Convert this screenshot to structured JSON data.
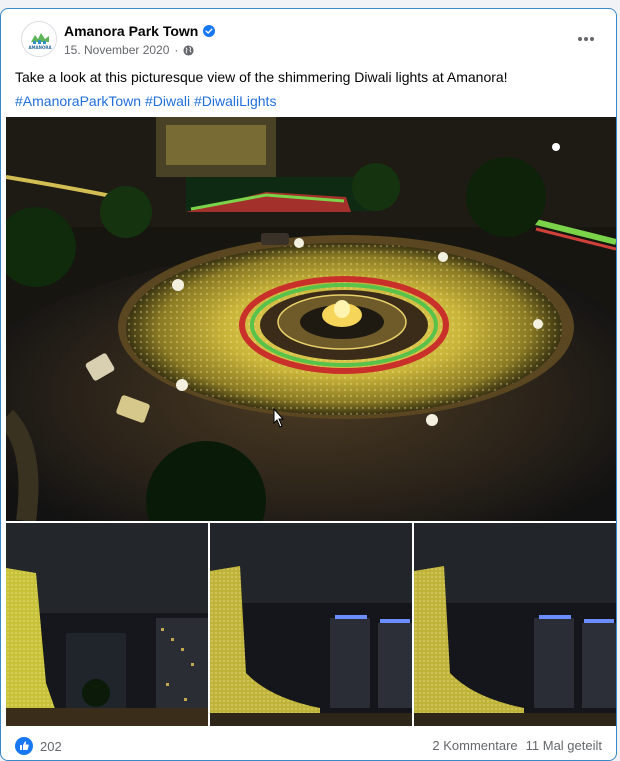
{
  "post": {
    "page_name": "Amanora Park Town",
    "avatar_text": "AMANORA",
    "date": "15. November 2020",
    "caption": "Take a look at this picturesque view of the shimmering Diwali lights at Amanora!",
    "hashtags": [
      "#AmanoraParkTown",
      "#Diwali",
      "#DiwaliLights"
    ]
  },
  "footer": {
    "reaction_count": "202",
    "comments": "2 Kommentare",
    "shares": "11 Mal geteilt"
  },
  "icons": {
    "verified": "verified-badge-icon",
    "globe": "globe-icon",
    "more": "more-options-icon",
    "like": "like-reaction-icon"
  },
  "colors": {
    "accent": "#1877f2",
    "hashtag": "#216fdb",
    "border": "#3b88c6",
    "muted": "#65676b"
  }
}
